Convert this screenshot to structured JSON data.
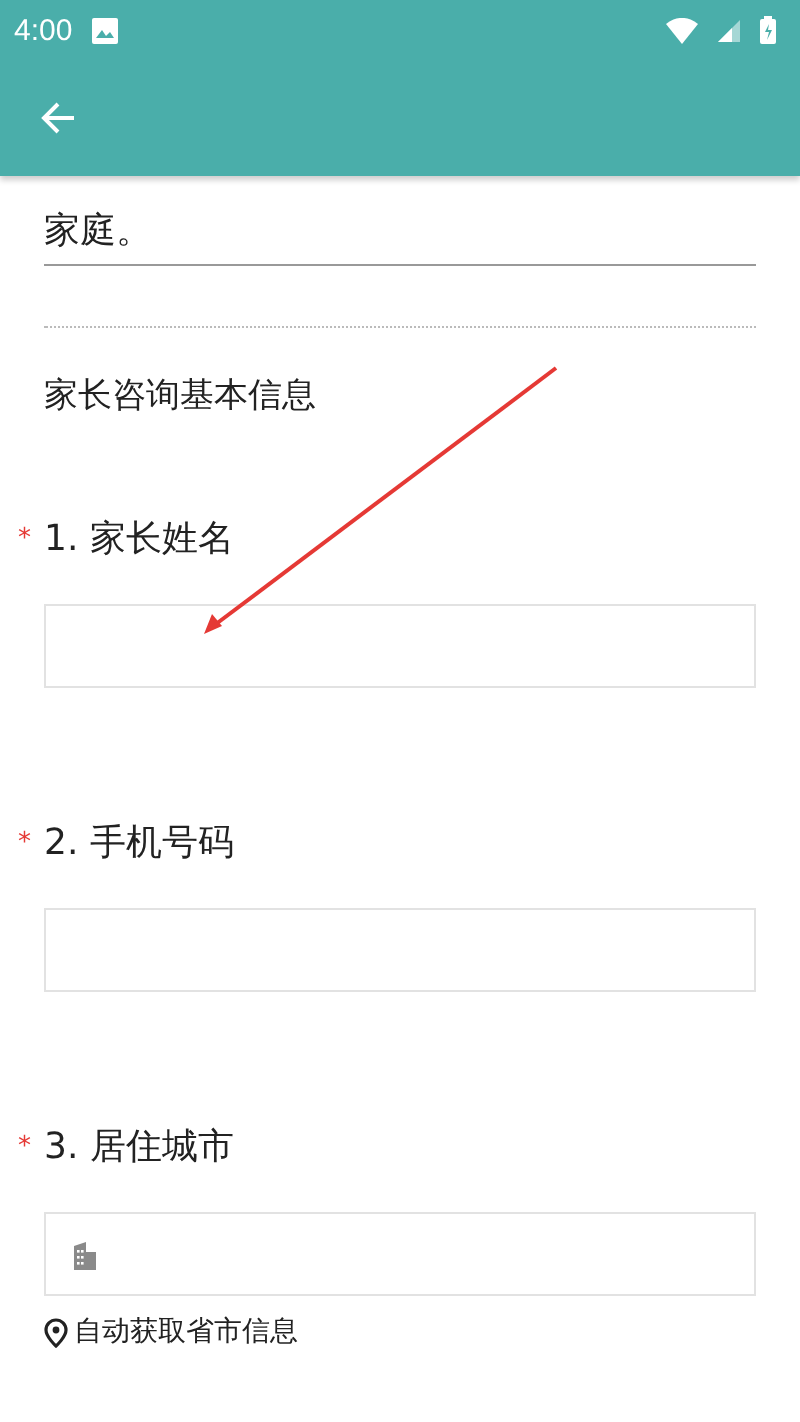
{
  "status_bar": {
    "time": "4:00"
  },
  "intro": {
    "text": "家庭。"
  },
  "section_title": "家长咨询基本信息",
  "questions": [
    {
      "required_mark": "*",
      "number": "1.",
      "label": "家长姓名",
      "kind": "text"
    },
    {
      "required_mark": "*",
      "number": "2.",
      "label": "手机号码",
      "kind": "text"
    },
    {
      "required_mark": "*",
      "number": "3.",
      "label": "居住城市",
      "kind": "city",
      "hint": "自动获取省市信息"
    }
  ]
}
